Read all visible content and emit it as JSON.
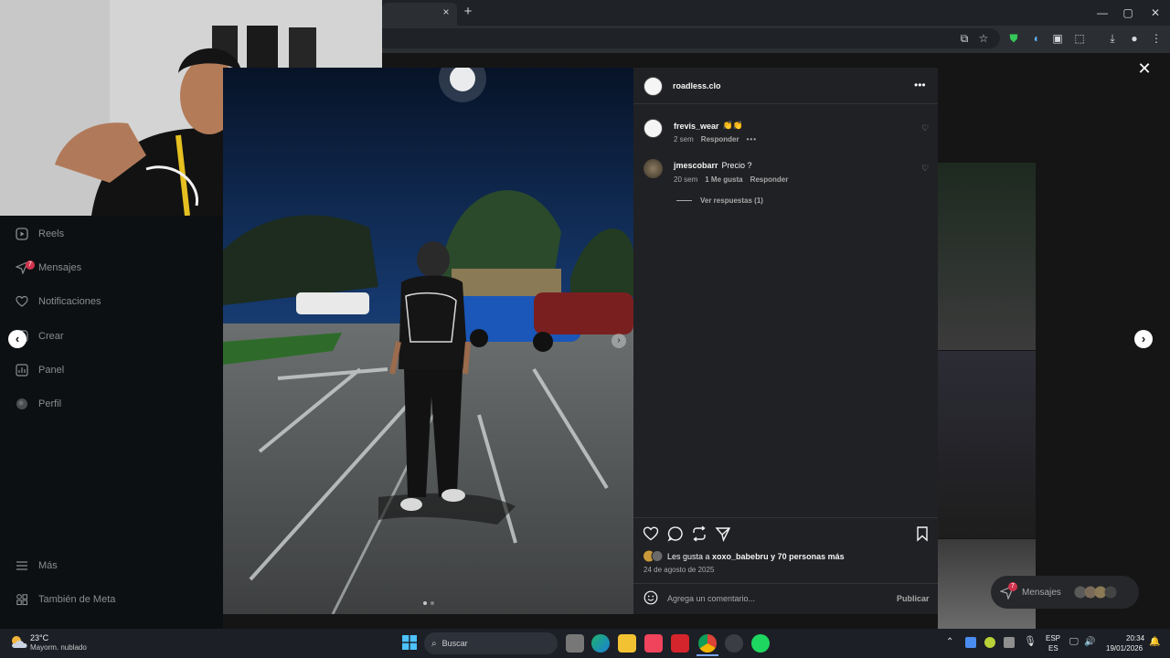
{
  "browser": {
    "tab_close": "×",
    "new_tab": "+",
    "window_controls": [
      "—",
      "▢",
      "✕"
    ]
  },
  "sidebar": {
    "items": [
      {
        "label": "Reels",
        "icon": "reels-icon"
      },
      {
        "label": "Mensajes",
        "icon": "messages-icon",
        "badge": "7"
      },
      {
        "label": "Notificaciones",
        "icon": "heart-icon"
      },
      {
        "label": "Crear",
        "icon": "plus-icon"
      },
      {
        "label": "Panel",
        "icon": "dashboard-icon"
      },
      {
        "label": "Perfil",
        "icon": "profile-icon"
      }
    ],
    "more": "Más",
    "meta": "También de Meta"
  },
  "post": {
    "author": "roadless.clo",
    "comments": [
      {
        "user": "frevis_wear",
        "text": "👏👏",
        "age": "2 sem",
        "likes": "",
        "reply": "Responder"
      },
      {
        "user": "jmescobarr",
        "text": "Precio ?",
        "age": "20 sem",
        "likes": "1 Me gusta",
        "reply": "Responder"
      }
    ],
    "view_replies": "Ver respuestas (1)",
    "liked_by_prefix": "Les gusta a ",
    "liked_by_user": "xoxo_babebru",
    "liked_by_suffix": " y 70 personas más",
    "date": "24 de agosto de 2025",
    "comment_placeholder": "Agrega un comentario...",
    "publish": "Publicar"
  },
  "floating_messages": {
    "label": "Mensajes",
    "badge": "7"
  },
  "taskbar": {
    "weather_temp": "23°C",
    "weather_desc": "Mayorm. nublado",
    "search": "Buscar",
    "lang_top": "ESP",
    "lang_bottom": "ES",
    "time": "20:34",
    "date": "19/01/2026"
  },
  "colors": {
    "accent": "#0095f6",
    "badge": "#ff3040"
  }
}
